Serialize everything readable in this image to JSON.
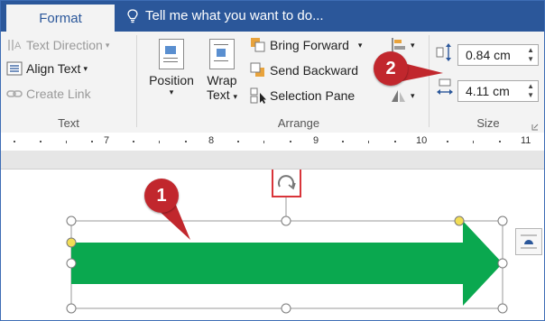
{
  "tabs": {
    "format": "Format",
    "tell_me": "Tell me what you want to do..."
  },
  "text_group": {
    "title": "Text",
    "text_direction": "Text Direction",
    "align_text": "Align Text",
    "create_link": "Create Link"
  },
  "arrange_group": {
    "title": "Arrange",
    "position": "Position",
    "wrap_text_line1": "Wrap",
    "wrap_text_line2": "Text",
    "bring_forward": "Bring Forward",
    "send_backward": "Send Backward",
    "selection_pane": "Selection Pane"
  },
  "size_group": {
    "title": "Size",
    "height_value": "0.84 cm",
    "width_value": "4.11 cm"
  },
  "ruler": {
    "labels": [
      "7",
      "8",
      "9",
      "10",
      "11"
    ]
  },
  "callouts": {
    "one": "1",
    "two": "2"
  },
  "colors": {
    "title_bar": "#2b579a",
    "arrow_fill": "#0aa84f",
    "callout": "#c1272d",
    "rotate_highlight": "#d9343a"
  }
}
